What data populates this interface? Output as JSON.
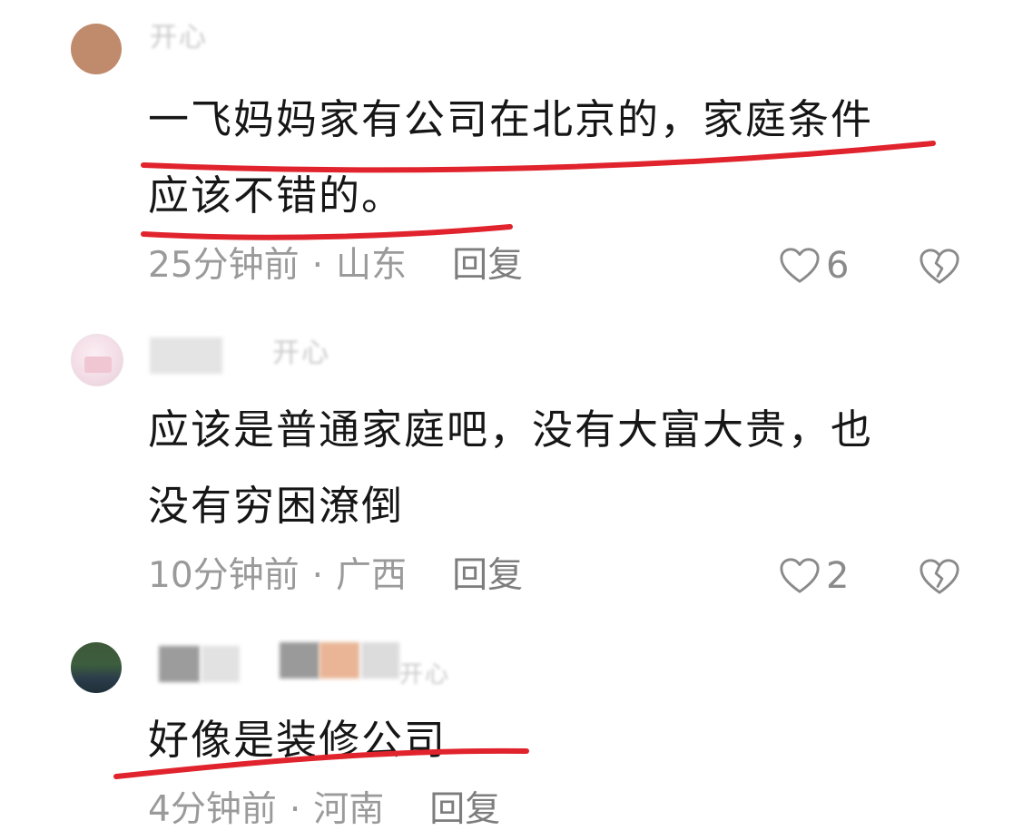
{
  "comments": [
    {
      "username": "开心",
      "content": [
        "一飞妈妈家有公司在北京的，家庭条件",
        "应该不错的。"
      ],
      "time": "25分钟前",
      "location": "山东",
      "reply_label": "回复",
      "like_count": "6"
    },
    {
      "username": "开心",
      "content": [
        "应该是普通家庭吧，没有大富大贵，也",
        "没有穷困潦倒"
      ],
      "time": "10分钟前",
      "location": "广西",
      "reply_label": "回复",
      "like_count": "2"
    },
    {
      "username": "开心",
      "content": [
        "好像是装修公司"
      ],
      "time": "4分钟前",
      "location": "河南",
      "reply_label": "回复"
    }
  ],
  "annotation_color": "#e0232c",
  "icons": {
    "like": "heart-outline-icon",
    "dislike": "broken-heart-icon"
  }
}
